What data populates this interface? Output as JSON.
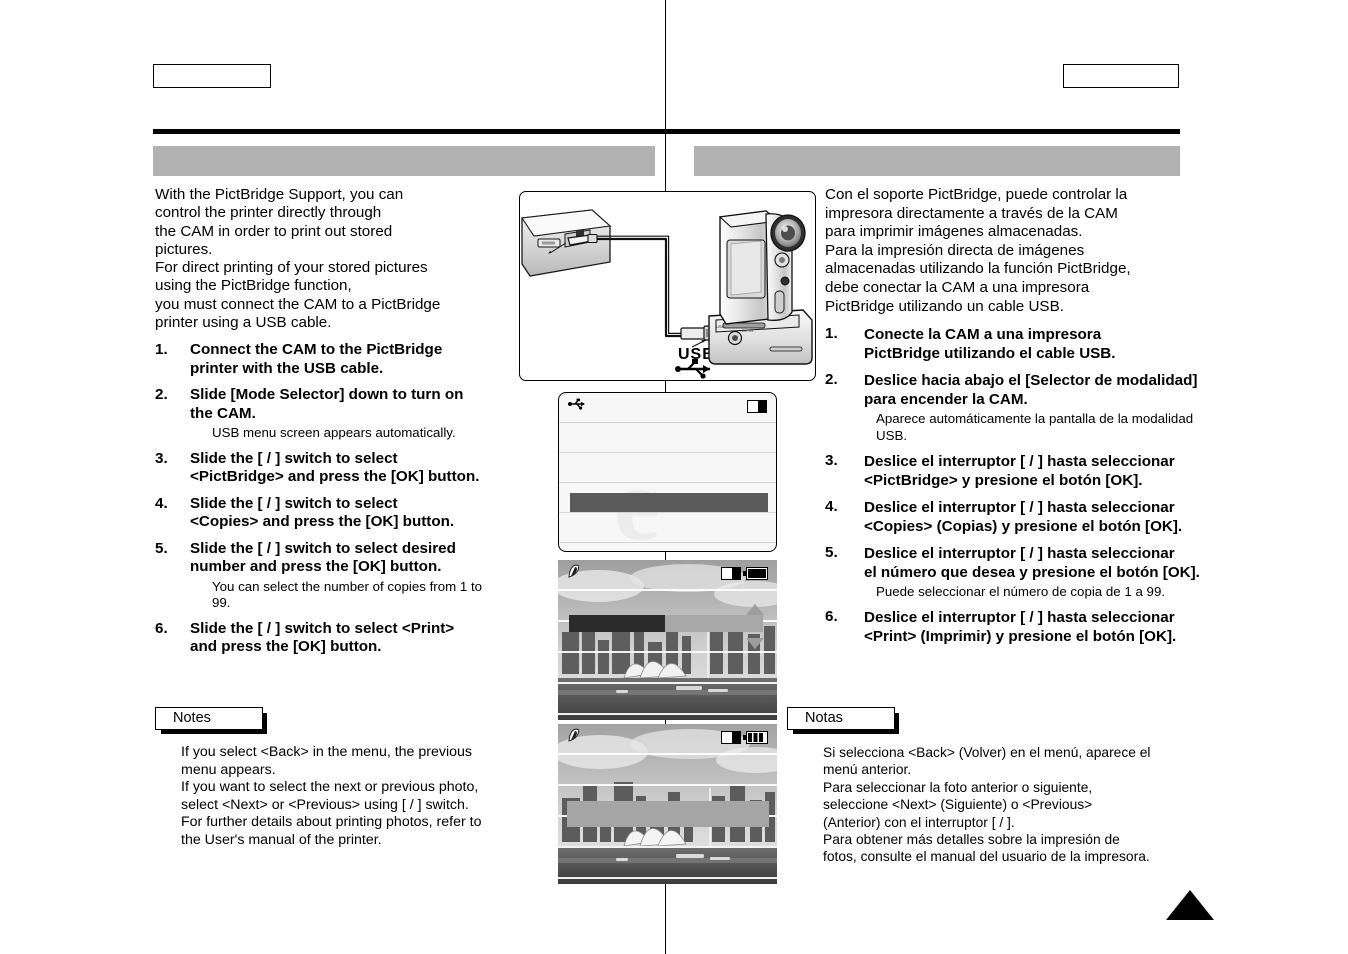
{
  "header": {
    "left_box_label": "",
    "right_box_label": ""
  },
  "title_bars": {
    "left": "",
    "right": ""
  },
  "english": {
    "intro": "With the PictBridge Support, you can\ncontrol the printer directly through\nthe CAM in order to print out stored\npictures.\nFor direct printing of your stored pictures\nusing the PictBridge function,\nyou must connect the CAM to a PictBridge\nprinter using a USB cable.",
    "steps": [
      {
        "num": "1.",
        "text": "Connect the CAM to the PictBridge\nprinter with the USB cable.",
        "note": ""
      },
      {
        "num": "2.",
        "text": "Slide [Mode Selector] down to turn on\nthe CAM.",
        "note": "USB menu screen appears automatically."
      },
      {
        "num": "3.",
        "text": "Slide the [    /    ] switch to select\n<PictBridge> and press the [OK] button.",
        "note": ""
      },
      {
        "num": "4.",
        "text": "Slide the [    /    ] switch to select\n<Copies> and press the [OK] button.",
        "note": ""
      },
      {
        "num": "5.",
        "text": "Slide the [    /    ] switch to select desired\nnumber and press the [OK] button.",
        "note": "You can select the number of copies from 1 to\n99."
      },
      {
        "num": "6.",
        "text": "Slide the [    /    ] switch to select <Print>\nand press the [OK] button.",
        "note": ""
      }
    ],
    "notes_label": "Notes",
    "notes_body": "If you select <Back> in the menu, the previous\nmenu appears.\nIf you want to select the next or previous photo,\nselect <Next> or <Previous> using [    /    ] switch.\nFor further details about printing photos, refer to\nthe User's manual of the printer."
  },
  "spanish": {
    "intro": "Con el soporte PictBridge, puede controlar la\nimpresora directamente a través de la CAM\npara imprimir imágenes almacenadas.\nPara la impresión directa de imágenes\nalmacenadas utilizando la función PictBridge,\ndebe conectar la CAM a una impresora\nPictBridge utilizando un cable USB.",
    "steps": [
      {
        "num": "1.",
        "text": "Conecte la CAM a una impresora\nPictBridge utilizando el cable USB.",
        "note": ""
      },
      {
        "num": "2.",
        "text": "Deslice hacia abajo el [Selector de modalidad]\npara encender la CAM.",
        "note": "Aparece automáticamente la pantalla de la modalidad\nUSB."
      },
      {
        "num": "3.",
        "text": "Deslice el interruptor [    /    ] hasta seleccionar\n<PictBridge> y presione el botón [OK].",
        "note": ""
      },
      {
        "num": "4.",
        "text": "Deslice el interruptor [    /    ] hasta seleccionar\n<Copies> (Copias) y presione el botón [OK].",
        "note": ""
      },
      {
        "num": "5.",
        "text": "Deslice el interruptor [    /    ] hasta seleccionar\nel número que desea y presione el botón [OK].",
        "note": "Puede seleccionar el número de copia de 1 a 99."
      },
      {
        "num": "6.",
        "text": "Deslice el interruptor [    /    ] hasta seleccionar\n<Print> (Imprimir) y presione el botón [OK].",
        "note": ""
      }
    ],
    "notes_label": "Notas",
    "notes_body": "Si selecciona <Back> (Volver) en el menú, aparece el\nmenú anterior.\nPara seleccionar la foto anterior o siguiente,\nseleccione <Next> (Siguiente) o <Previous>\n(Anterior) con el interruptor [    /    ].\nPara obtener más detalles sobre la impresión de\nfotos, consulte el manual del usuario de la impresora."
  },
  "illustration": {
    "usb_label": "USB",
    "description": "CAM on docking cradle connected by USB cable to a printer"
  },
  "lcd_screens": [
    {
      "name": "usb-mode-menu",
      "left_icon": "usb-icon",
      "right_icons": [
        "memory-card-icon"
      ],
      "selected_row_label": "",
      "rows": [
        "",
        "",
        "",
        "",
        ""
      ]
    },
    {
      "name": "copies-selection",
      "left_icon": "photo-mode-icon",
      "right_icons": [
        "memory-card-icon",
        "battery-icon"
      ],
      "selected_row_label": "",
      "value_label": "",
      "has_up_arrow": true,
      "has_down_arrow": true
    },
    {
      "name": "print-selection",
      "left_icon": "photo-mode-icon",
      "right_icons": [
        "memory-card-icon",
        "battery-full-icon"
      ],
      "selected_row_label": ""
    }
  ],
  "colors": {
    "title_bar": "#b2b2b2",
    "rule": "#000000",
    "highlight_dark": "#5a5a5a",
    "highlight_light": "#a8a8a8"
  }
}
